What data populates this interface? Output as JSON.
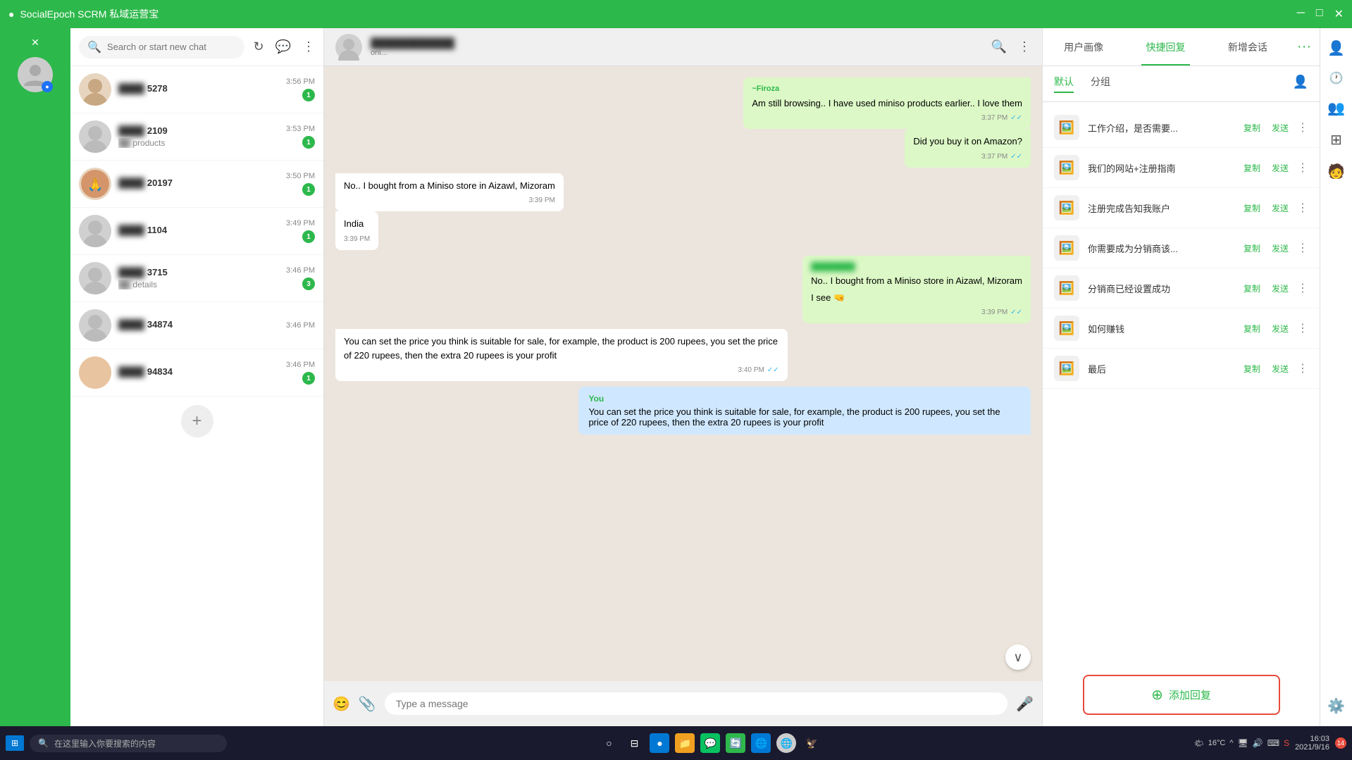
{
  "app": {
    "title": "SocialEpoch SCRM 私域运营宝",
    "title_bar_controls": [
      "─",
      "□",
      "✕"
    ]
  },
  "search": {
    "placeholder": "Search or start new chat"
  },
  "chat_list": {
    "items": [
      {
        "id": 1,
        "name": "5278",
        "preview": "",
        "time": "3:56 PM",
        "badge": 1,
        "avatar_type": "photo"
      },
      {
        "id": 2,
        "name": "2109",
        "preview": "products",
        "time": "3:53 PM",
        "badge": 1,
        "avatar_type": "default"
      },
      {
        "id": 3,
        "name": "20197",
        "preview": "",
        "time": "3:50 PM",
        "badge": 1,
        "avatar_type": "color1"
      },
      {
        "id": 4,
        "name": "1104",
        "preview": "",
        "time": "3:49 PM",
        "badge": 1,
        "avatar_type": "default"
      },
      {
        "id": 5,
        "name": "3715",
        "preview": "details",
        "time": "3:46 PM",
        "badge": 3,
        "avatar_type": "default"
      },
      {
        "id": 6,
        "name": "34874",
        "preview": "",
        "time": "3:46 PM",
        "badge": 0,
        "avatar_type": "default"
      },
      {
        "id": 7,
        "name": "94834",
        "preview": "",
        "time": "3:46 PM",
        "badge": 1,
        "avatar_type": "photo2"
      }
    ]
  },
  "active_contact": {
    "name": "blurred",
    "status": "online"
  },
  "messages": [
    {
      "id": 1,
      "type": "outgoing",
      "sender": "~Firoza",
      "text": "Am still browsing.. I have used miniso products earlier.. I love them",
      "time": "3:37 PM",
      "ticks": "✓✓"
    },
    {
      "id": 2,
      "type": "outgoing",
      "text": "Did you buy it on Amazon?",
      "time": "3:37 PM",
      "ticks": "✓✓"
    },
    {
      "id": 3,
      "type": "incoming",
      "text": "No.. I bought from a Miniso store in Aizawl, Mizoram",
      "time": "3:39 PM"
    },
    {
      "id": 4,
      "type": "incoming",
      "text": "India",
      "time": "3:39 PM"
    },
    {
      "id": 5,
      "type": "outgoing",
      "sender": "~Firoza",
      "text": "No.. I bought from a Miniso store in Aizawl, Mizoram",
      "subtext": "I see 🤜",
      "time": "3:39 PM",
      "ticks": "✓✓"
    },
    {
      "id": 6,
      "type": "incoming",
      "text": "You can set the price you think is suitable for sale, for example, the product is 200 rupees, you set the price of 220 rupees, then the extra 20 rupees is your profit",
      "time": "3:40 PM",
      "ticks": "✓✓"
    },
    {
      "id": 7,
      "type": "outgoing_preview",
      "sender": "You",
      "text": "You can set the price you think is suitable for sale, for example, the product is 200 rupees, you set the price of 220 rupees, then the extra 20 rupees is your profit"
    }
  ],
  "message_input": {
    "placeholder": "Type a message"
  },
  "right_panel": {
    "tabs": [
      "用户画像",
      "快捷回复",
      "新增会话"
    ],
    "active_tab": 1,
    "subtabs": [
      "默认",
      "分组"
    ],
    "active_subtab": 0,
    "quick_replies": [
      {
        "id": 1,
        "text": "工作介绍，是否需要..."
      },
      {
        "id": 2,
        "text": "我们的网站+注册指南"
      },
      {
        "id": 3,
        "text": "注册完成告知我账户"
      },
      {
        "id": 4,
        "text": "你需要成为分销商该..."
      },
      {
        "id": 5,
        "text": "分销商已经设置成功"
      },
      {
        "id": 6,
        "text": "如何赚钱"
      },
      {
        "id": 7,
        "text": "最后"
      }
    ],
    "copy_label": "复制",
    "send_label": "发送",
    "add_reply_label": "添加回复"
  },
  "taskbar": {
    "search_placeholder": "在这里输入你要搜索的内容",
    "time": "16:03",
    "date": "2021/9/16",
    "temperature": "16°C",
    "notification_count": "14"
  }
}
